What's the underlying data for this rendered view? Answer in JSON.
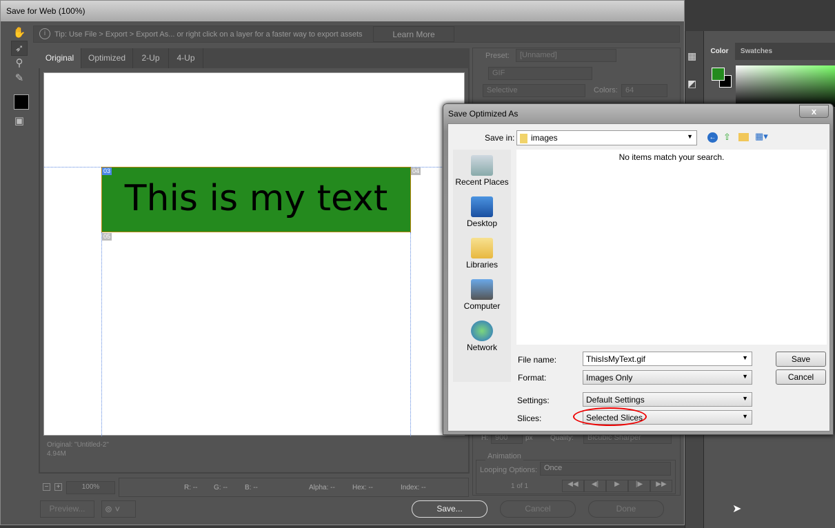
{
  "window": {
    "title": "Save for Web (100%)"
  },
  "tip": {
    "text": "Tip: Use File > Export > Export As...  or right click on a layer for a faster way to export assets",
    "learn_more": "Learn More"
  },
  "tabs": [
    {
      "label": "Original"
    },
    {
      "label": "Optimized"
    },
    {
      "label": "2-Up"
    },
    {
      "label": "4-Up"
    }
  ],
  "canvas": {
    "text": "This is my text",
    "green": "#248a1e",
    "slices": [
      "03",
      "04",
      "05"
    ]
  },
  "info": {
    "name": "Original: \"Untitled-2\"",
    "size": "4.94M"
  },
  "settings": {
    "preset_label": "Preset:",
    "preset": "[Unnamed]",
    "format": "GIF",
    "reduction": "Selective",
    "colors_label": "Colors:",
    "colors": "64",
    "h_label": "H:",
    "h": "900",
    "px": "px",
    "quality_label": "Quality:",
    "quality": "Bicubic Sharper"
  },
  "animation": {
    "label": "Animation",
    "looping_label": "Looping Options:",
    "looping": "Once",
    "frame": "1 of 1"
  },
  "statusbar": {
    "zoom": "100%",
    "r": "R: --",
    "g": "G: --",
    "b": "B: --",
    "alpha": "Alpha: --",
    "hex": "Hex: --",
    "index": "Index: --"
  },
  "buttons": {
    "preview": "Preview...",
    "save": "Save...",
    "cancel": "Cancel",
    "done": "Done"
  },
  "panel": {
    "tabs": [
      "Color",
      "Swatches"
    ],
    "fg": "#248a1e",
    "bg": "#000000"
  },
  "dialog": {
    "title": "Save Optimized As",
    "close": "x",
    "save_in_label": "Save in:",
    "save_in": "images",
    "empty": "No items match your search.",
    "places": [
      "Recent Places",
      "Desktop",
      "Libraries",
      "Computer",
      "Network"
    ],
    "file_name_label": "File name:",
    "file_name": "ThisIsMyText.gif",
    "format_label": "Format:",
    "format": "Images Only",
    "settings_label": "Settings:",
    "settings": "Default Settings",
    "slices_label": "Slices:",
    "slices": "Selected Slices",
    "save": "Save",
    "cancel": "Cancel"
  }
}
